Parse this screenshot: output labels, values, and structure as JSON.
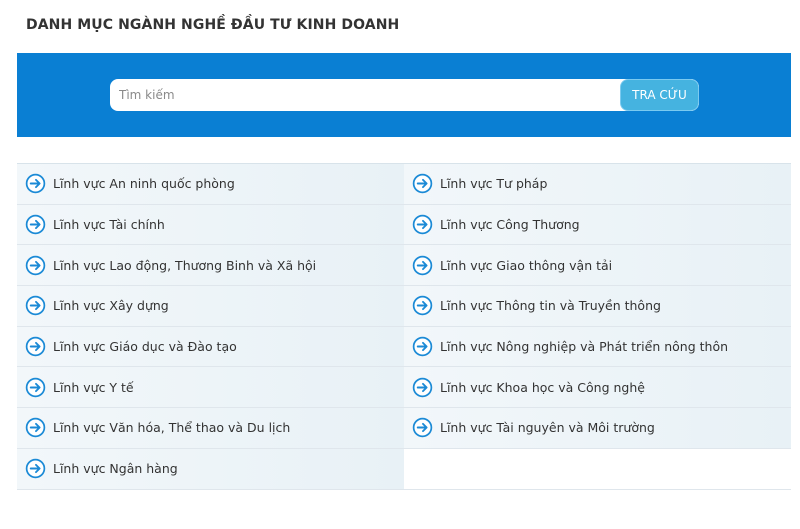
{
  "page": {
    "title": "DANH MỤC NGÀNH NGHỀ ĐẦU TƯ KINH DOANH"
  },
  "search": {
    "placeholder": "Tìm kiếm",
    "value": "",
    "button_label": "TRA CỨU"
  },
  "categories": {
    "items": [
      "Lĩnh vực An ninh quốc phòng",
      "Lĩnh vực Tư pháp",
      "Lĩnh vực Tài chính",
      "Lĩnh vực Công Thương",
      "Lĩnh vực Lao động, Thương Binh và Xã hội",
      "Lĩnh vực Giao thông vận tải",
      "Lĩnh vực Xây dựng",
      "Lĩnh vực Thông tin và Truyền thông",
      "Lĩnh vực Giáo dục và Đào tạo",
      "Lĩnh vực Nông nghiệp và Phát triển nông thôn",
      "Lĩnh vực Y tế",
      "Lĩnh vực Khoa học và Công nghệ",
      "Lĩnh vực Văn hóa, Thể thao và Du lịch",
      "Lĩnh vực Tài nguyên và Môi trường",
      "Lĩnh vực Ngân hàng"
    ],
    "icon": "arrow-right-circle-icon"
  },
  "colors": {
    "banner": "#0a7fd3",
    "button": "#45b3e0",
    "icon": "#1b8ad6"
  }
}
